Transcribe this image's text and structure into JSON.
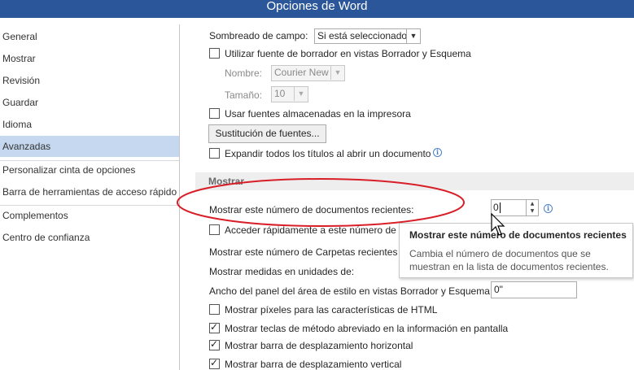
{
  "window": {
    "title": "Opciones de Word"
  },
  "sidebar": {
    "items": [
      {
        "label": "General"
      },
      {
        "label": "Mostrar"
      },
      {
        "label": "Revisión"
      },
      {
        "label": "Guardar"
      },
      {
        "label": "Idioma"
      },
      {
        "label": "Avanzadas",
        "selected": true
      },
      {
        "label": "Personalizar cinta de opciones"
      },
      {
        "label": "Barra de herramientas de acceso rápido"
      },
      {
        "label": "Complementos"
      },
      {
        "label": "Centro de confianza"
      }
    ]
  },
  "settings": {
    "field_shading": {
      "label": "Sombreado de campo:",
      "value": "Si está seleccionado"
    },
    "draft_font": {
      "label": "Utilizar fuente de borrador en vistas Borrador y Esquema",
      "checked": false
    },
    "font_name": {
      "label": "Nombre:",
      "value": "Courier New"
    },
    "font_size": {
      "label": "Tamaño:",
      "value": "10"
    },
    "printer_fonts": {
      "label": "Usar fuentes almacenadas en la impresora",
      "checked": false
    },
    "font_substitution_button": "Sustitución de fuentes...",
    "expand_headings": {
      "label": "Expandir todos los títulos al abrir un documento",
      "checked": false
    }
  },
  "display_section": {
    "heading": "Mostrar",
    "recent_docs": {
      "label": "Mostrar este número de documentos recientes:",
      "value": "0"
    },
    "quick_access": {
      "label": "Acceder rápidamente a este número de D",
      "checked": false
    },
    "recent_folders": {
      "label": "Mostrar este número de Carpetas recientes o"
    },
    "units": {
      "label": "Mostrar medidas en unidades de:"
    },
    "style_pane": {
      "label": "Ancho del panel del área de estilo en vistas Borrador y Esquema:",
      "value": "0\""
    },
    "html_pixels": {
      "label": "Mostrar píxeles para las características de HTML",
      "checked": false
    },
    "shortcut_keys": {
      "label": "Mostrar teclas de método abreviado en la información en pantalla",
      "checked": true
    },
    "h_scrollbar": {
      "label": "Mostrar barra de desplazamiento horizontal",
      "checked": true
    },
    "v_scrollbar": {
      "label": "Mostrar barra de desplazamiento vertical",
      "checked": true
    }
  },
  "tooltip": {
    "title": "Mostrar este número de documentos recientes",
    "body": "Cambia el número de documentos que se muestran en la lista de documentos recientes."
  },
  "colors": {
    "title_bar": "#2b579a",
    "selected_nav": "#c5d8ef",
    "annotation": "#d81e27",
    "info": "#4a7fc6"
  },
  "icons": [
    "info-icon",
    "spinner-up-icon",
    "spinner-down-icon",
    "dropdown-arrow-icon",
    "mouse-pointer-icon"
  ]
}
